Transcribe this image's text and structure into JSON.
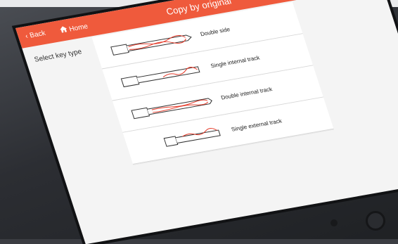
{
  "header": {
    "title": "Copy by original",
    "back_label": "Back",
    "home_label": "Home"
  },
  "section": {
    "label": "Select key type"
  },
  "key_types": [
    {
      "label": "Double side",
      "icon": "double-side-key-icon"
    },
    {
      "label": "Single internal track",
      "icon": "single-internal-track-key-icon"
    },
    {
      "label": "Double internal track",
      "icon": "double-internal-track-key-icon"
    },
    {
      "label": "Single external track",
      "icon": "single-external-track-key-icon"
    }
  ],
  "colors": {
    "accent": "#ef5a3c",
    "cut_line": "#e53b2a",
    "background": "#f4f4f4"
  }
}
